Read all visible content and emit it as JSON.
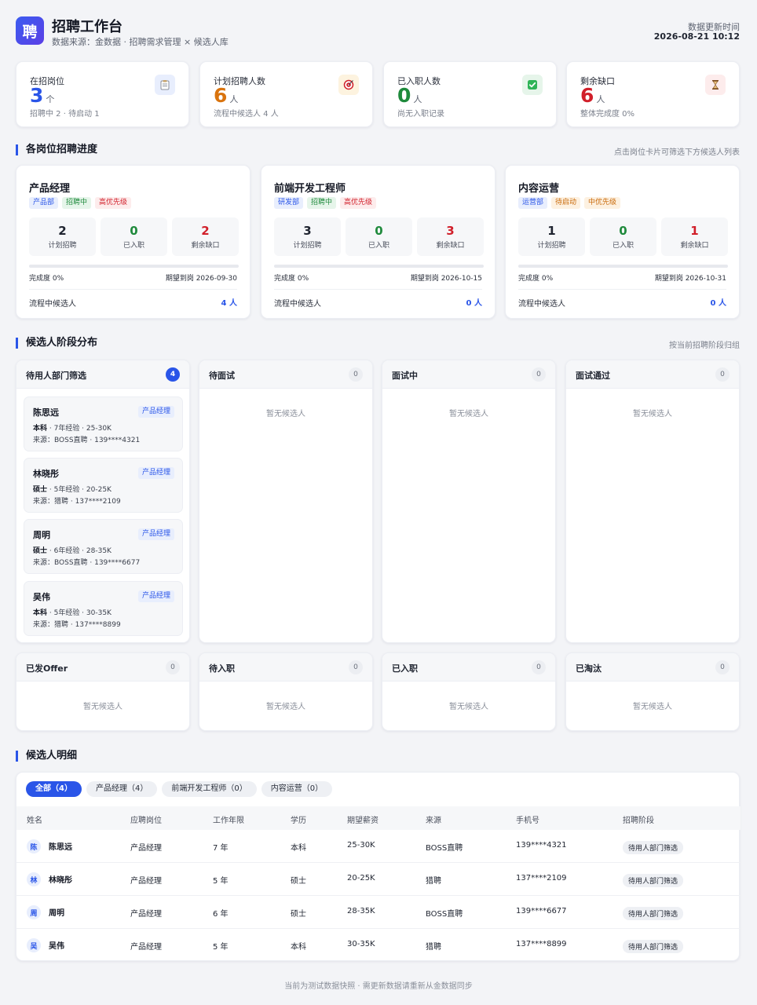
{
  "header": {
    "logo": "聘",
    "title": "招聘工作台",
    "subtitle": "数据来源：金数据 · 招聘需求管理 × 候选人库",
    "update_label": "数据更新时间",
    "update_time": "2026-08-21 10:12"
  },
  "stats": [
    {
      "label": "在招岗位",
      "value": "3",
      "unit": "个",
      "sub": "招聘中 2 · 待启动 1",
      "icon": "clipboard-icon",
      "color": "#2a55e8"
    },
    {
      "label": "计划招聘人数",
      "value": "6",
      "unit": "人",
      "sub": "流程中候选人 4 人",
      "icon": "target-icon",
      "color": "#d9730d"
    },
    {
      "label": "已入职人数",
      "value": "0",
      "unit": "人",
      "sub": "尚无入职记录",
      "icon": "check-icon",
      "color": "#1f8a3c"
    },
    {
      "label": "剩余缺口",
      "value": "6",
      "unit": "人",
      "sub": "整体完成度 0%",
      "icon": "hourglass-icon",
      "color": "#d11f2a"
    }
  ],
  "progress_section": {
    "title": "各岗位招聘进度",
    "hint": "点击岗位卡片可筛选下方候选人列表"
  },
  "positions": [
    {
      "name": "产品经理",
      "tags": [
        {
          "text": "产品部",
          "tone": "blue"
        },
        {
          "text": "招聘中",
          "tone": "green"
        },
        {
          "text": "高优先级",
          "tone": "red"
        }
      ],
      "plan": "2",
      "plan_label": "计划招聘",
      "hired": "0",
      "hired_label": "已入职",
      "gap": "2",
      "gap_label": "剩余缺口",
      "completion": "完成度 0%",
      "completion_pct": 0,
      "due": "期望到岗 2026-09-30",
      "flow_label": "流程中候选人",
      "flow_value": "4 人"
    },
    {
      "name": "前端开发工程师",
      "tags": [
        {
          "text": "研发部",
          "tone": "blue"
        },
        {
          "text": "招聘中",
          "tone": "green"
        },
        {
          "text": "高优先级",
          "tone": "red"
        }
      ],
      "plan": "3",
      "plan_label": "计划招聘",
      "hired": "0",
      "hired_label": "已入职",
      "gap": "3",
      "gap_label": "剩余缺口",
      "completion": "完成度 0%",
      "completion_pct": 0,
      "due": "期望到岗 2026-10-15",
      "flow_label": "流程中候选人",
      "flow_value": "0 人"
    },
    {
      "name": "内容运营",
      "tags": [
        {
          "text": "运营部",
          "tone": "blue"
        },
        {
          "text": "待启动",
          "tone": "orange"
        },
        {
          "text": "中优先级",
          "tone": "orange"
        }
      ],
      "plan": "1",
      "plan_label": "计划招聘",
      "hired": "0",
      "hired_label": "已入职",
      "gap": "1",
      "gap_label": "剩余缺口",
      "completion": "完成度 0%",
      "completion_pct": 0,
      "due": "期望到岗 2026-10-31",
      "flow_label": "流程中候选人",
      "flow_value": "0 人"
    }
  ],
  "stage_section": {
    "title": "候选人阶段分布",
    "hint": "按当前招聘阶段归组"
  },
  "stages": [
    {
      "name": "待用人部门筛选",
      "count": "4",
      "empty": ""
    },
    {
      "name": "待面试",
      "count": "0",
      "empty": "暂无候选人"
    },
    {
      "name": "面试中",
      "count": "0",
      "empty": "暂无候选人"
    },
    {
      "name": "面试通过",
      "count": "0",
      "empty": "暂无候选人"
    },
    {
      "name": "已发Offer",
      "count": "0",
      "empty": "暂无候选人"
    },
    {
      "name": "待入职",
      "count": "0",
      "empty": "暂无候选人"
    },
    {
      "name": "已入职",
      "count": "0",
      "empty": "暂无候选人"
    },
    {
      "name": "已淘汰",
      "count": "0",
      "empty": "暂无候选人"
    }
  ],
  "stage_cards": [
    {
      "name": "陈思远",
      "tag": "产品经理",
      "edu": "本科",
      "info": " · 7年经验 · 25-30K",
      "source": "来源：BOSS直聘 · 139****4321"
    },
    {
      "name": "林晓彤",
      "tag": "产品经理",
      "edu": "硕士",
      "info": " · 5年经验 · 20-25K",
      "source": "来源：猎聘 · 137****2109"
    },
    {
      "name": "周明",
      "tag": "产品经理",
      "edu": "硕士",
      "info": " · 6年经验 · 28-35K",
      "source": "来源：BOSS直聘 · 139****6677"
    },
    {
      "name": "吴伟",
      "tag": "产品经理",
      "edu": "本科",
      "info": " · 5年经验 · 30-35K",
      "source": "来源：猎聘 · 137****8899"
    }
  ],
  "detail_section": {
    "title": "候选人明细"
  },
  "filters": [
    "全部（4）",
    "产品经理（4）",
    "前端开发工程师（0）",
    "内容运营（0）"
  ],
  "table": {
    "headers": [
      "姓名",
      "应聘岗位",
      "工作年限",
      "学历",
      "期望薪资",
      "来源",
      "手机号",
      "招聘阶段"
    ],
    "rows": [
      {
        "avatar": "陈",
        "name": "陈思远",
        "position": "产品经理",
        "years": "7 年",
        "edu": "本科",
        "salary": "25-30K",
        "source": "BOSS直聘",
        "phone": "139****4321",
        "stage": "待用人部门筛选"
      },
      {
        "avatar": "林",
        "name": "林晓彤",
        "position": "产品经理",
        "years": "5 年",
        "edu": "硕士",
        "salary": "20-25K",
        "source": "猎聘",
        "phone": "137****2109",
        "stage": "待用人部门筛选"
      },
      {
        "avatar": "周",
        "name": "周明",
        "position": "产品经理",
        "years": "6 年",
        "edu": "硕士",
        "salary": "28-35K",
        "source": "BOSS直聘",
        "phone": "139****6677",
        "stage": "待用人部门筛选"
      },
      {
        "avatar": "吴",
        "name": "吴伟",
        "position": "产品经理",
        "years": "5 年",
        "edu": "本科",
        "salary": "30-35K",
        "source": "猎聘",
        "phone": "137****8899",
        "stage": "待用人部门筛选"
      }
    ]
  },
  "footer": "当前为测试数据快照 · 需更新数据请重新从金数据同步"
}
